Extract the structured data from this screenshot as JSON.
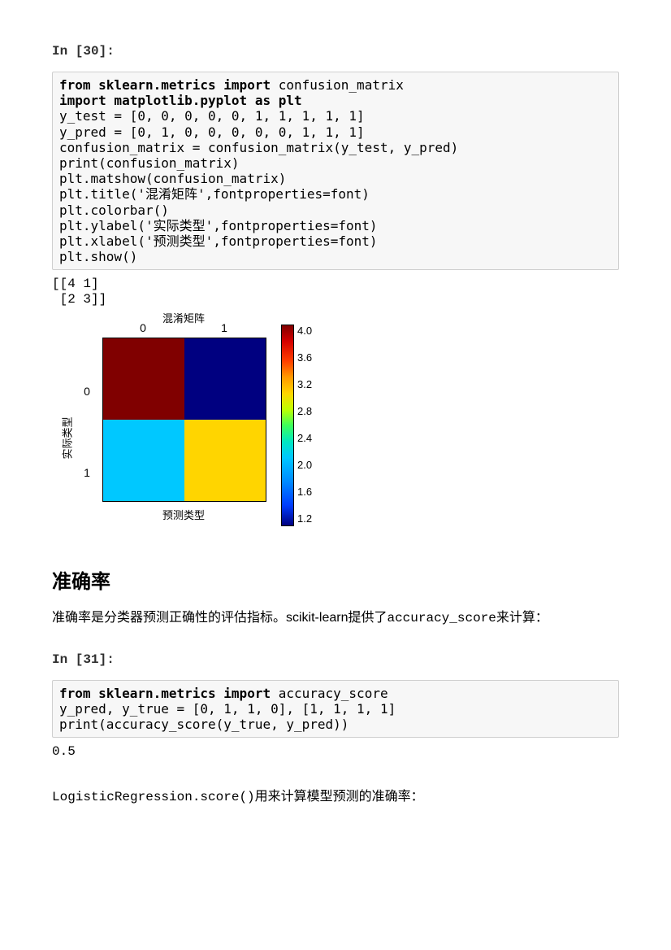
{
  "cell1": {
    "prompt": "In [30]:",
    "line1_kw": "from sklearn.metrics import",
    "line1_tail": " confusion_matrix",
    "line2_kw": "import matplotlib.pyplot as plt",
    "line3": "y_test = [0, 0, 0, 0, 0, 1, 1, 1, 1, 1]",
    "line4": "y_pred = [0, 1, 0, 0, 0, 0, 0, 1, 1, 1]",
    "line5": "confusion_matrix = confusion_matrix(y_test, y_pred)",
    "line6": "print(confusion_matrix)",
    "line7": "plt.matshow(confusion_matrix)",
    "line8": "plt.title('混淆矩阵',fontproperties=font)",
    "line9": "plt.colorbar()",
    "line10": "plt.ylabel('实际类型',fontproperties=font)",
    "line11": "plt.xlabel('预测类型',fontproperties=font)",
    "line12": "plt.show()"
  },
  "output1": "[[4 1]\n [2 3]]",
  "chart_data": {
    "type": "heatmap",
    "title": "混淆矩阵",
    "xlabel": "预测类型",
    "ylabel": "实际类型",
    "x_ticks": [
      "0",
      "1"
    ],
    "y_ticks": [
      "0",
      "1"
    ],
    "matrix": [
      [
        4,
        1
      ],
      [
        2,
        3
      ]
    ],
    "colors": [
      [
        "#800000",
        "#000080"
      ],
      [
        "#00c8ff",
        "#ffd500"
      ]
    ],
    "colorbar": {
      "ticks": [
        "4.0",
        "3.6",
        "3.2",
        "2.8",
        "2.4",
        "2.0",
        "1.6",
        "1.2"
      ],
      "gradient_css": "linear-gradient(to bottom, #800000 0%, #d40000 8%, #ff4000 18%, #ff9a00 26%, #ffd500 34%, #bfff00 42%, #3dff5a 50%, #00e8bf 58%, #00c8ff 66%, #008bff 78%, #003cff 90%, #000080 100%)"
    }
  },
  "section_heading": "准确率",
  "para1_a": "准确率是分类器预测正确性的评估指标。scikit-learn提供了",
  "para1_mono": "accuracy_score",
  "para1_b": "来计算：",
  "cell2": {
    "prompt": "In [31]:",
    "line1_kw": "from sklearn.metrics import",
    "line1_tail": " accuracy_score",
    "line2": "y_pred, y_true = [0, 1, 1, 0], [1, 1, 1, 1]",
    "line3": "print(accuracy_score(y_true, y_pred))"
  },
  "output2": "0.5",
  "trailing_mono": "LogisticRegression.score()",
  "trailing_txt": "用来计算模型预测的准确率："
}
